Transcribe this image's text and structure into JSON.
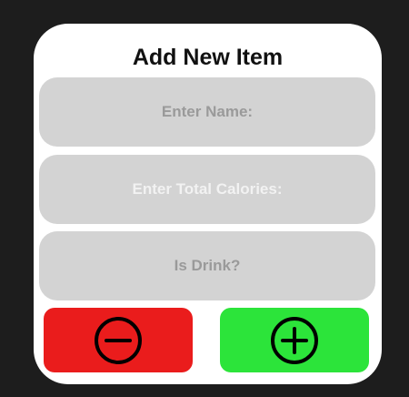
{
  "dialog": {
    "title": "Add New Item"
  },
  "fields": {
    "name_placeholder": "Enter Name:",
    "calories_placeholder": "Enter Total Calories:",
    "drink_placeholder": "Is Drink?"
  },
  "buttons": {
    "remove_icon": "minus-circle-icon",
    "add_icon": "plus-circle-icon"
  },
  "colors": {
    "background": "#1d1d1d",
    "dialog": "#ffffff",
    "field": "#d3d3d3",
    "remove": "#ea1c1c",
    "add": "#2ce43a"
  }
}
